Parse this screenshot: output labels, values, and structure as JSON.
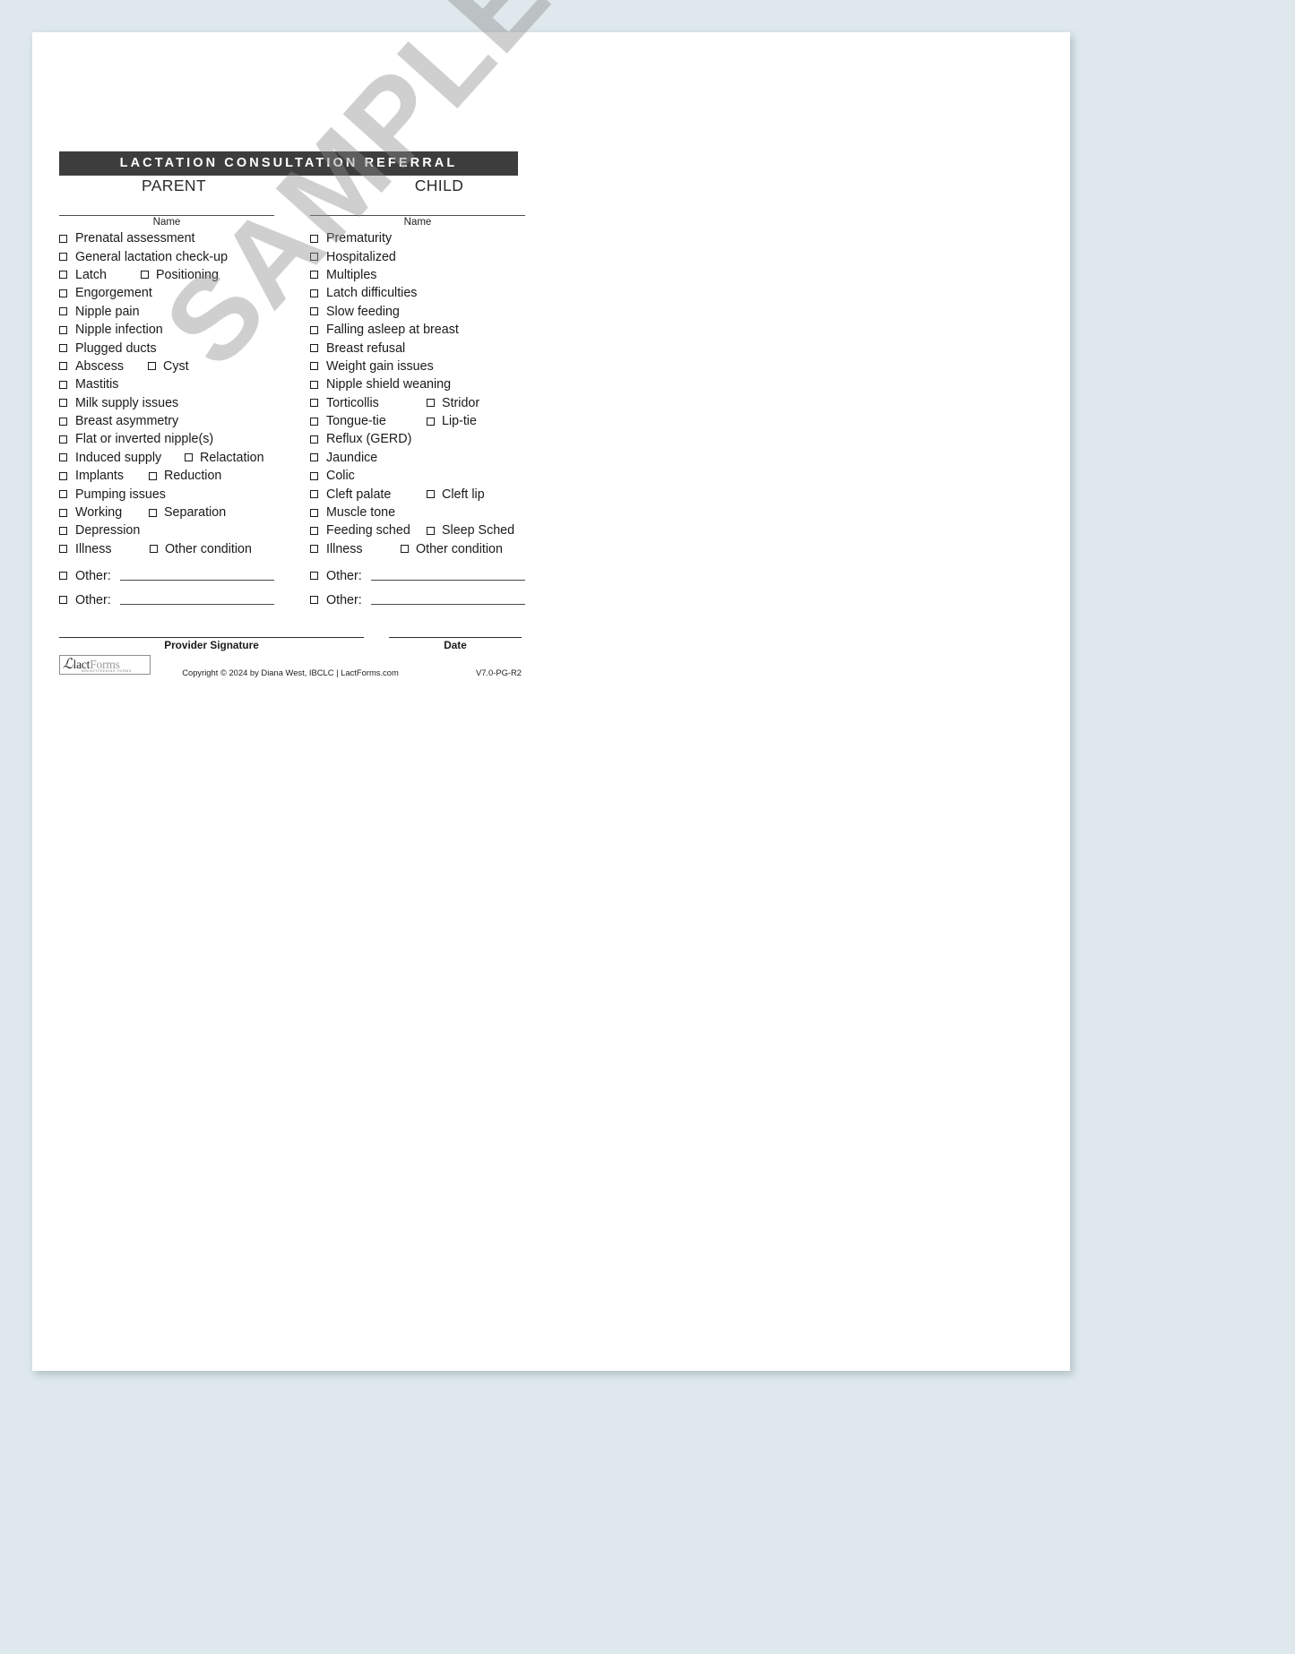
{
  "document": {
    "title": "LACTATION CONSULTATION REFERRAL",
    "watermark": "SAMPLE",
    "columns": [
      {
        "heading": "PARENT",
        "name_label": "Name",
        "items": [
          {
            "label": "Prenatal assessment"
          },
          {
            "label": "General lactation check-up"
          },
          {
            "label": "Latch",
            "second": "Positioning"
          },
          {
            "label": "Engorgement"
          },
          {
            "label": "Nipple pain"
          },
          {
            "label": "Nipple infection"
          },
          {
            "label": "Plugged ducts"
          },
          {
            "label": "Abscess",
            "second": "Cyst"
          },
          {
            "label": "Mastitis"
          },
          {
            "label": "Milk supply issues"
          },
          {
            "label": "Breast asymmetry"
          },
          {
            "label": "Flat or inverted nipple(s)"
          },
          {
            "label": "Induced supply",
            "second": "Relactation"
          },
          {
            "label": "Implants",
            "second": "Reduction"
          },
          {
            "label": "Pumping issues"
          },
          {
            "label": "Working",
            "second": "Separation"
          },
          {
            "label": "Depression"
          },
          {
            "label": "Illness",
            "second": "Other condition"
          }
        ],
        "other_rows": [
          {
            "label": "Other:",
            "value": ""
          },
          {
            "label": "Other:",
            "value": ""
          }
        ]
      },
      {
        "heading": "CHILD",
        "name_label": "Name",
        "items": [
          {
            "label": "Prematurity"
          },
          {
            "label": "Hospitalized"
          },
          {
            "label": "Multiples"
          },
          {
            "label": "Latch difficulties"
          },
          {
            "label": "Slow feeding"
          },
          {
            "label": "Falling asleep at breast"
          },
          {
            "label": "Breast refusal"
          },
          {
            "label": "Weight gain issues"
          },
          {
            "label": "Nipple shield weaning"
          },
          {
            "label": "Torticollis",
            "second": "Stridor"
          },
          {
            "label": "Tongue-tie",
            "second": "Lip-tie"
          },
          {
            "label": "Reflux (GERD)"
          },
          {
            "label": "Jaundice"
          },
          {
            "label": "Colic"
          },
          {
            "label": "Cleft palate",
            "second": "Cleft lip"
          },
          {
            "label": "Muscle tone"
          },
          {
            "label": "Feeding sched",
            "second": "Sleep Sched"
          },
          {
            "label": "Illness",
            "second": "Other condition"
          }
        ],
        "other_rows": [
          {
            "label": "Other:",
            "value": ""
          },
          {
            "label": "Other:",
            "value": ""
          }
        ]
      }
    ],
    "signature": {
      "provider_label": "Provider Signature",
      "date_label": "Date",
      "provider_value": "",
      "date_value": ""
    },
    "footer": {
      "logo_mark": "ℒ",
      "logo_lact": "lact",
      "logo_forms": "Forms",
      "logo_tagline": "BREASTFEEDING FORMS",
      "copyright": "Copyright © 2024 by Diana West, IBCLC  |  LactForms.com",
      "version": "V7.0-PG-R2"
    }
  },
  "theme": {
    "title_bar_bg": "#3d3d3d",
    "title_bar_text": "#ffffff",
    "page_bg": "#dfe9ed",
    "paper_bg": "#ffffff",
    "rule_color": "#4a4a4a",
    "text_color": "#1a1a1a",
    "watermark_color": "#8c8c8c"
  }
}
